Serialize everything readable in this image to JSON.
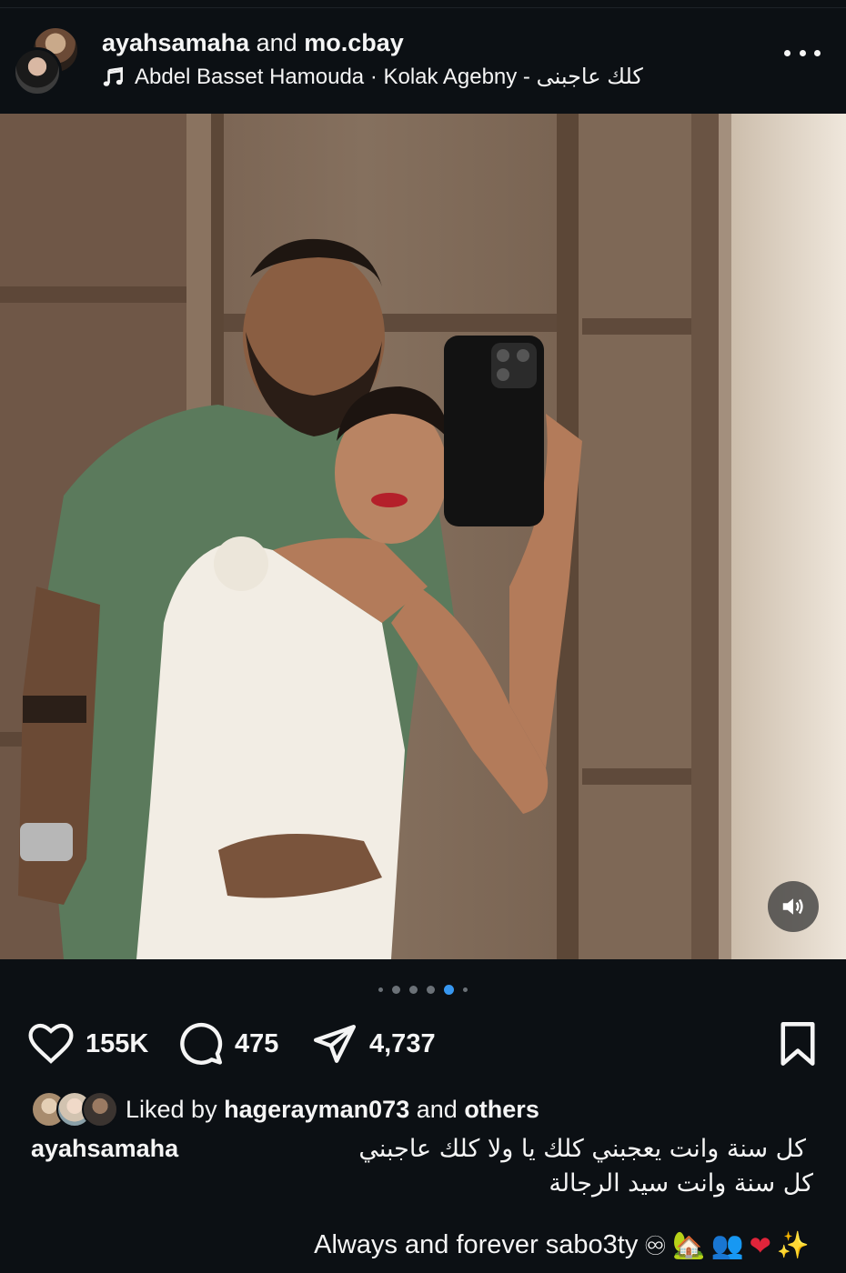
{
  "post": {
    "author_primary": "ayahsamaha",
    "joiner": "and",
    "author_secondary": "mo.cbay",
    "music": "Abdel Basset Hamouda · Kolak Agebny - كلك عاجبنى"
  },
  "carousel": {
    "total": 5,
    "active_index": 3
  },
  "actions": {
    "likes": "155K",
    "comments": "475",
    "shares": "4,737"
  },
  "liked_by": {
    "prefix": "Liked by",
    "user": "hagerayman073",
    "joiner": "and",
    "suffix": "others"
  },
  "caption": {
    "user": "ayahsamaha",
    "line1": "كل سنة وانت يعجبني كلك يا ولا كلك عاجبني",
    "line2": "كل سنة وانت سيد الرجالة",
    "line3": "Always and forever sabo3ty",
    "emojis": [
      "♾",
      "🏡",
      "👥",
      "❤",
      "✨"
    ]
  },
  "icons": {
    "more": "more-options-icon",
    "music": "music-note-icon",
    "like": "heart-icon",
    "comment": "comment-icon",
    "share": "share-icon",
    "save": "bookmark-icon",
    "sound": "speaker-icon"
  },
  "colors": {
    "background": "#0c1014",
    "text": "#f5f5f5",
    "active_dot": "#3797f0"
  }
}
